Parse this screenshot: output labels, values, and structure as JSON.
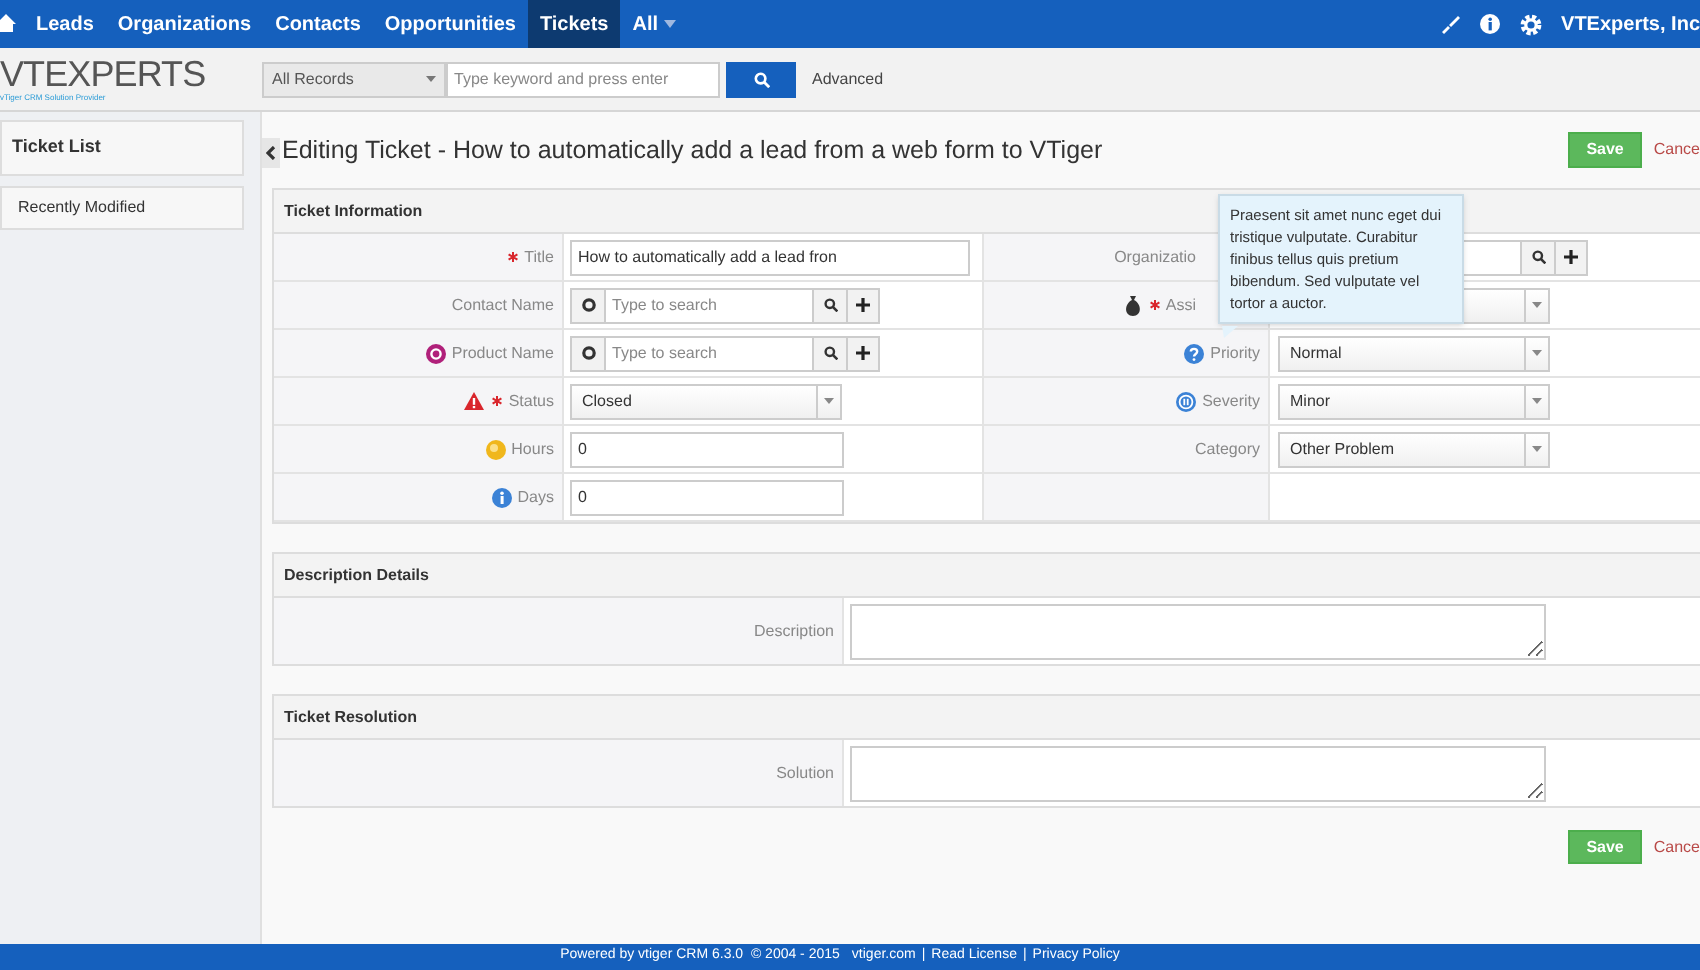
{
  "top_nav": {
    "items": [
      {
        "label": "Leads",
        "selected": false
      },
      {
        "label": "Organizations",
        "selected": false
      },
      {
        "label": "Contacts",
        "selected": false
      },
      {
        "label": "Opportunities",
        "selected": false
      },
      {
        "label": "Tickets",
        "selected": true
      },
      {
        "label": "All",
        "selected": false
      }
    ],
    "user": "VTExperts, Inc"
  },
  "header": {
    "logo": "VTEXPERTS",
    "tagline": "vTiger CRM Solution Provider",
    "filter": "All Records",
    "search_placeholder": "Type keyword and press enter",
    "advanced": "Advanced"
  },
  "sidebar": {
    "title": "Ticket List",
    "items": [
      "Recently Modified"
    ]
  },
  "page": {
    "title": "Editing Ticket - How to automatically add a lead from a web form to VTiger",
    "save": "Save",
    "cancel": "Cance"
  },
  "ticket_information": {
    "title": "Ticket Information",
    "rows": [
      {
        "left": {
          "label": "Title",
          "required": true,
          "kind": "text",
          "value": "How to automatically add a lead fron"
        },
        "right": {
          "label": "Organizatio",
          "required": false,
          "covered": true,
          "kind": "lookup"
        }
      },
      {
        "left": {
          "label": "Contact Name",
          "required": false,
          "kind": "lookup",
          "placeholder": "Type to search"
        },
        "right": {
          "label": "Assi",
          "required": true,
          "covered": true,
          "kind": "select"
        }
      },
      {
        "left": {
          "label": "Product Name",
          "required": false,
          "kind": "lookup",
          "placeholder": "Type to search"
        },
        "right": {
          "label": "Priority",
          "required": false,
          "kind": "select",
          "value": "Normal"
        }
      },
      {
        "left": {
          "label": "Status",
          "required": true,
          "kind": "select",
          "value": "Closed"
        },
        "right": {
          "label": "Severity",
          "required": false,
          "kind": "select",
          "value": "Minor"
        }
      },
      {
        "left": {
          "label": "Hours",
          "required": false,
          "kind": "text",
          "value": "0"
        },
        "right": {
          "label": "Category",
          "required": false,
          "kind": "select",
          "value": "Other Problem"
        }
      },
      {
        "left": {
          "label": "Days",
          "required": false,
          "kind": "text",
          "value": "0"
        }
      }
    ]
  },
  "tooltip": "Praesent sit amet nunc eget dui tristique vulputate. Curabitur finibus tellus quis pretium bibendum. Sed vulputate vel tortor a auctor.",
  "text_sections": [
    {
      "title": "Description Details",
      "label": "Description"
    },
    {
      "title": "Ticket Resolution",
      "label": "Solution"
    }
  ],
  "bottom_actions": {
    "save": "Save",
    "cancel": "Cance"
  },
  "footer": {
    "text": "Powered by vtiger CRM 6.3.0  © 2004 - 2015",
    "links": [
      "vtiger.com",
      "Read License",
      "Privacy Policy"
    ],
    "separator": "|"
  }
}
